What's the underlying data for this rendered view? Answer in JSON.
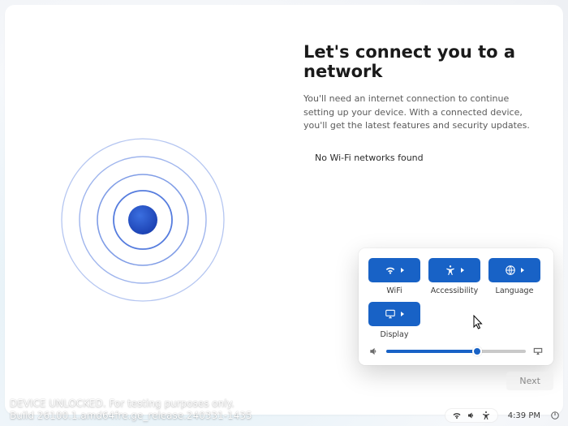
{
  "page": {
    "title": "Let's connect you to a network",
    "subtitle": "You'll need an internet connection to continue setting up your device. With a connected device, you'll get the latest features and security updates.",
    "status": "No Wi-Fi networks found"
  },
  "quick_settings": {
    "items": [
      {
        "label": "WiFi",
        "icon": "wifi-icon"
      },
      {
        "label": "Accessibility",
        "icon": "accessibility-icon"
      },
      {
        "label": "Language",
        "icon": "language-icon"
      },
      {
        "label": "Display",
        "icon": "display-icon"
      }
    ],
    "volume_percent": 65
  },
  "footer": {
    "next_label": "Next"
  },
  "watermark": {
    "line1": "DEVICE UNLOCKED. For testing purposes only.",
    "line2": "Build 26100.1.amd64fre.ge_release.240331-1435"
  },
  "tray": {
    "time": "4:39 PM"
  },
  "colors": {
    "accent": "#1862c6"
  }
}
